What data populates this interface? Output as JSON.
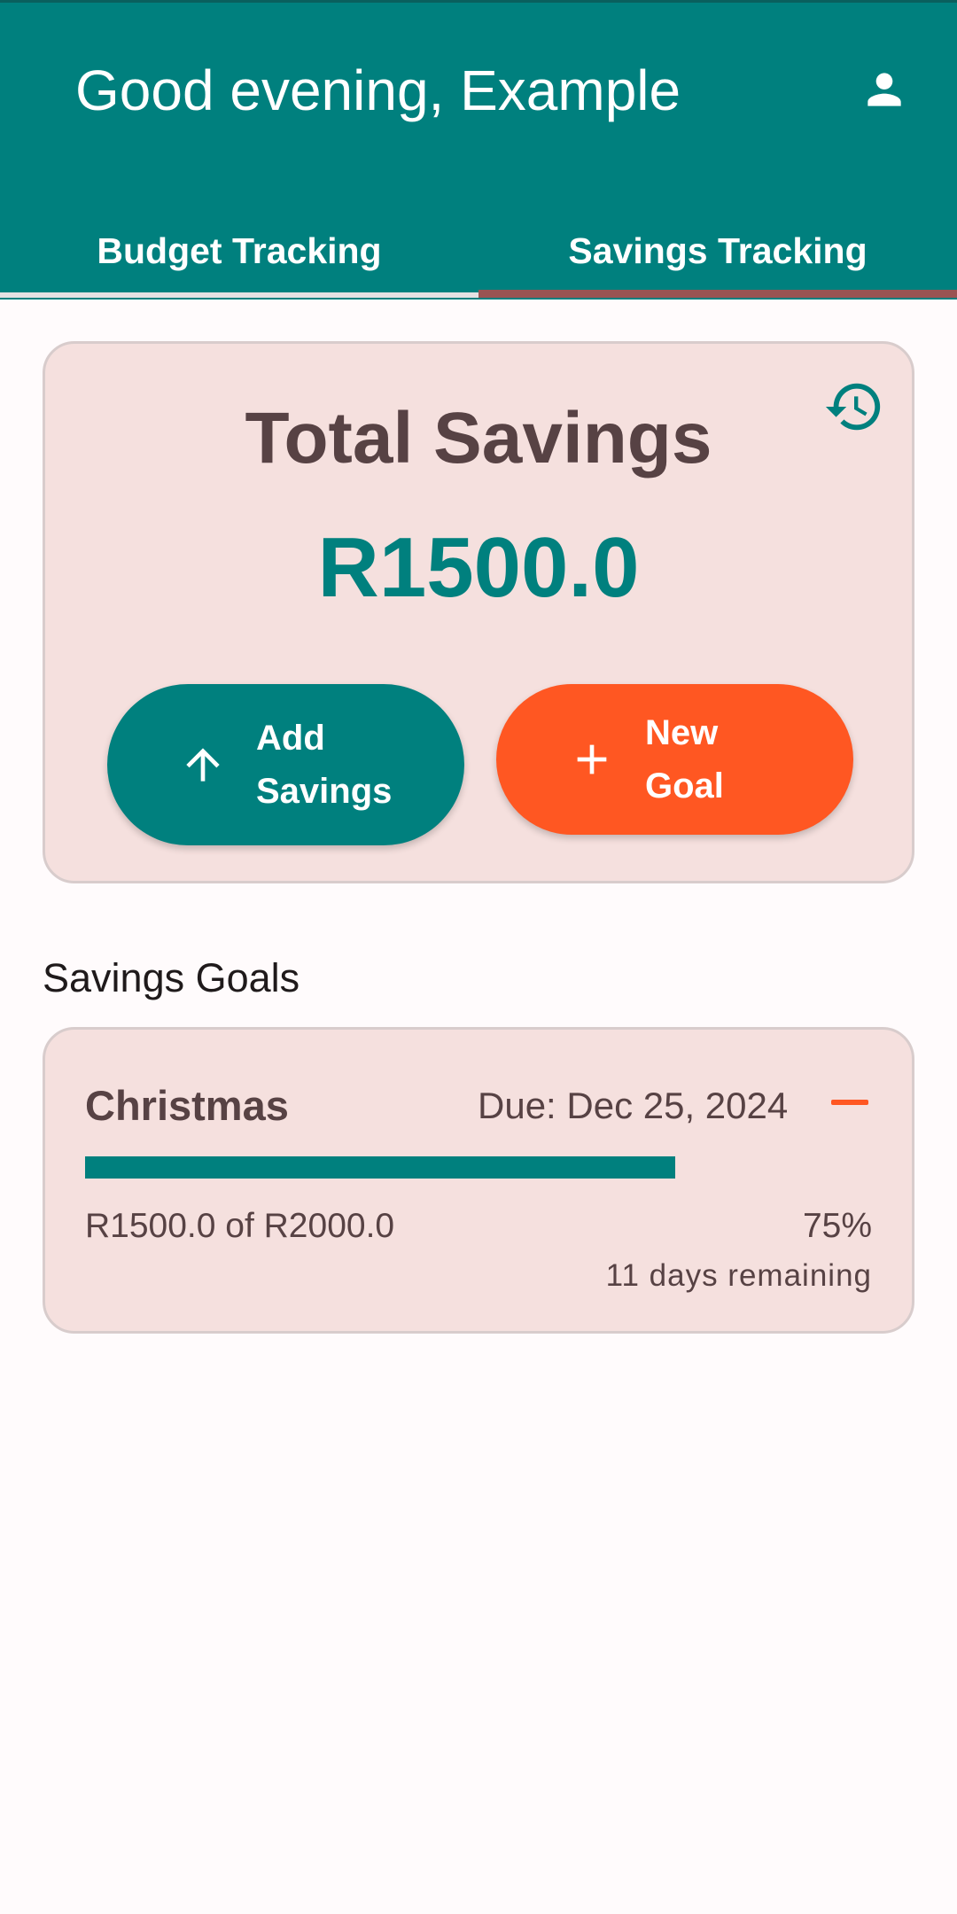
{
  "appbar": {
    "greeting": "Good evening, Example",
    "profile_icon": "person-icon"
  },
  "tabs": [
    {
      "label": "Budget Tracking",
      "selected": false
    },
    {
      "label": "Savings Tracking",
      "selected": true
    }
  ],
  "summary": {
    "title": "Total Savings",
    "amount": "R1500.0",
    "history_icon": "history-icon",
    "add_savings_label": "Add Savings",
    "new_goal_label": "New Goal"
  },
  "goals_section": {
    "title": "Savings Goals",
    "goals": [
      {
        "name": "Christmas",
        "due": "Due: Dec 25, 2024",
        "amounts": "R1500.0 of R2000.0",
        "percent_text": "75%",
        "progress": 0.75,
        "remaining": "11 days remaining"
      }
    ]
  },
  "colors": {
    "primary": "#00807e",
    "accent": "#ff5722",
    "card_bg": "#f5e0de",
    "tab_indicator": "#9a5452",
    "text_dark": "#574244"
  }
}
